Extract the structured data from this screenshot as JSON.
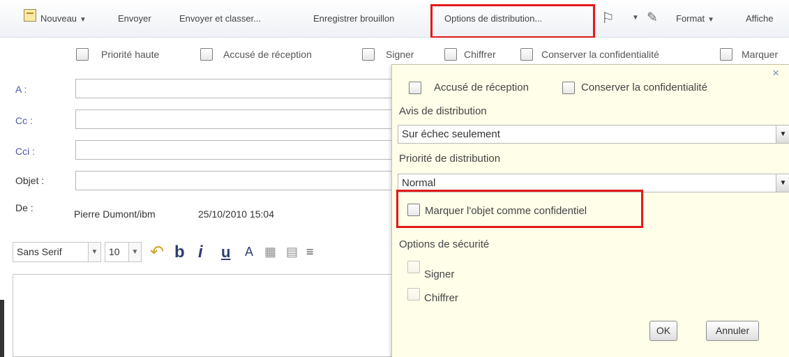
{
  "toolbar": {
    "new_label": "Nouveau",
    "send_label": "Envoyer",
    "send_file_label": "Envoyer et classer...",
    "save_draft_label": "Enregistrer brouillon",
    "delivery_options_label": "Options de distribution...",
    "format_label": "Format",
    "display_label": "Affiche",
    "icons": [
      "new-message-icon",
      "flag-icon",
      "paperclip-icon"
    ]
  },
  "options_row": {
    "high_priority": "Priorité haute",
    "return_receipt": "Accusé de réception",
    "sign": "Signer",
    "encrypt": "Chiffrer",
    "keep_private": "Conserver la confidentialité",
    "mark": "Marquer"
  },
  "fields": {
    "to": "A :",
    "cc": "Cc :",
    "bcc": "Cci :",
    "subject": "Objet :",
    "from_label": "De :",
    "from_name": "Pierre Dumont/ibm",
    "from_date": "25/10/2010 15:04"
  },
  "editor": {
    "font_name": "Sans Serif",
    "font_size": "10",
    "bold": "b",
    "italic": "i",
    "underline": "u"
  },
  "popup": {
    "close": "×",
    "return_receipt": "Accusé de réception",
    "keep_private": "Conserver la confidentialité",
    "delivery_notice_label": "Avis de distribution",
    "delivery_notice_value": "Sur échec seulement",
    "delivery_priority_label": "Priorité de distribution",
    "delivery_priority_value": "Normal",
    "mark_confidential": "Marquer l'objet comme confidentiel",
    "security_options_label": "Options de sécurité",
    "sign": "Signer",
    "encrypt": "Chiffrer",
    "ok": "OK",
    "cancel": "Annuler"
  },
  "colors": {
    "highlight": "#e41818",
    "field_label_blue": "#4a55b0",
    "popup_background": "#fffee9"
  }
}
